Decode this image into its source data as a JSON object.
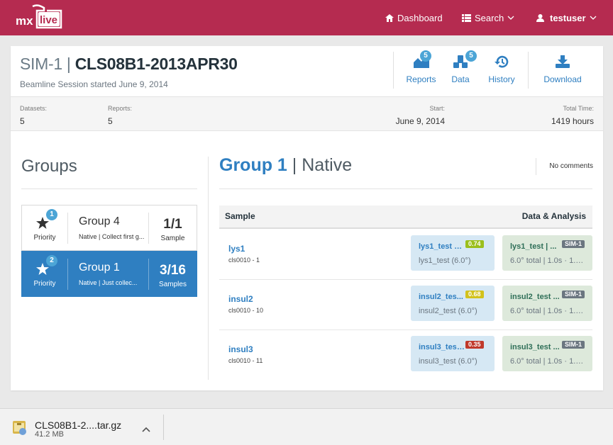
{
  "nav": {
    "dashboard": "Dashboard",
    "search": "Search",
    "user": "testuser"
  },
  "session": {
    "project": "SIM-1",
    "name": "CLS08B1-2013APR30",
    "subtitle": "Beamline Session started June 9, 2014"
  },
  "tools": {
    "reports_label": "Reports",
    "reports_count": "5",
    "data_label": "Data",
    "data_count": "5",
    "history_label": "History",
    "download_label": "Download"
  },
  "stats": {
    "datasets_label": "Datasets:",
    "datasets_value": "5",
    "reports_label": "Reports:",
    "reports_value": "5",
    "start_label": "Start:",
    "start_value": "June 9, 2014",
    "total_label": "Total Time:",
    "total_value": "1419 hours"
  },
  "groups": {
    "title": "Groups",
    "items": [
      {
        "rank": "1",
        "priority": "Priority",
        "name": "Group 4",
        "desc": "Native | Collect first g...",
        "count": "1/1",
        "count_label": "Sample"
      },
      {
        "rank": "2",
        "priority": "Priority",
        "name": "Group 1",
        "desc": "Native | Just collec...",
        "count": "3/16",
        "count_label": "Samples"
      }
    ]
  },
  "detail": {
    "group": "Group 1",
    "kind": "Native",
    "comments": "No comments",
    "col_sample": "Sample",
    "col_data": "Data & Analysis",
    "rows": [
      {
        "name": "lys1",
        "id": "cls0010 - 1",
        "data_title": "lys1_test | ...",
        "score": "0.74",
        "score_color": "#9bbf1c",
        "data_sub": "lys1_test (6.0°)",
        "rep_title": "lys1_test | ...",
        "rep_tag": "SIM-1",
        "rep_sub": "6.0° total | 1.0s · 1.0..."
      },
      {
        "name": "insul2",
        "id": "cls0010 - 10",
        "data_title": "insul2_tes...",
        "score": "0.68",
        "score_color": "#d2c21c",
        "data_sub": "insul2_test (6.0°)",
        "rep_title": "insul2_test ...",
        "rep_tag": "SIM-1",
        "rep_sub": "6.0° total | 1.0s · 1.0..."
      },
      {
        "name": "insul3",
        "id": "cls0010 - 11",
        "data_title": "insul3_test...",
        "score": "0.35",
        "score_color": "#c0392b",
        "data_sub": "insul3_test (6.0°)",
        "rep_title": "insul3_test ...",
        "rep_tag": "SIM-1",
        "rep_sub": "6.0° total | 1.0s · 1.0..."
      }
    ]
  },
  "download": {
    "filename": "CLS08B1-2....tar.gz",
    "size": "41.2 MB"
  },
  "colors": {
    "brand": "#b52b50",
    "accent": "#2f7fc1",
    "badge": "#4ca5d6"
  }
}
